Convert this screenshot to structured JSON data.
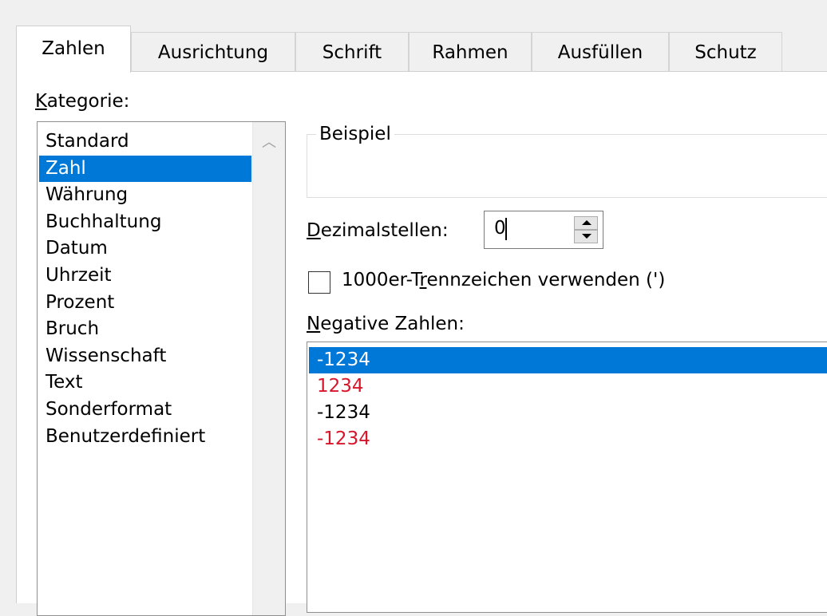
{
  "tabs": [
    {
      "label": "Zahlen",
      "active": true
    },
    {
      "label": "Ausrichtung",
      "active": false
    },
    {
      "label": "Schrift",
      "active": false
    },
    {
      "label": "Rahmen",
      "active": false
    },
    {
      "label": "Ausfüllen",
      "active": false
    },
    {
      "label": "Schutz",
      "active": false
    }
  ],
  "category": {
    "label_accel": "K",
    "label_rest": "ategorie:",
    "items": [
      "Standard",
      "Zahl",
      "Währung",
      "Buchhaltung",
      "Datum",
      "Uhrzeit",
      "Prozent",
      "Bruch",
      "Wissenschaft",
      "Text",
      "Sonderformat",
      "Benutzerdefiniert"
    ],
    "selected_index": 1
  },
  "sample": {
    "title": "Beispiel",
    "value": ""
  },
  "decimal": {
    "label_accel": "D",
    "label_rest": "ezimalstellen:",
    "value": "0"
  },
  "thousands": {
    "label_pre": "1000er-T",
    "label_accel": "r",
    "label_post": "ennzeichen verwenden (')",
    "checked": false
  },
  "negative": {
    "label_accel": "N",
    "label_rest": "egative Zahlen:",
    "items": [
      {
        "text": "-1234",
        "color": "#000000",
        "selected": true
      },
      {
        "text": "1234",
        "color": "#d6162a",
        "selected": false
      },
      {
        "text": "-1234",
        "color": "#000000",
        "selected": false
      },
      {
        "text": "-1234",
        "color": "#d6162a",
        "selected": false
      }
    ]
  },
  "colors": {
    "selection": "#0078d7",
    "negative_red": "#d6162a"
  }
}
